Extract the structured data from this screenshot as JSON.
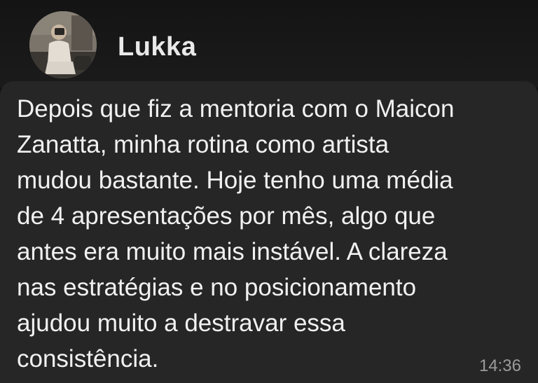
{
  "contact": {
    "name": "Lukka",
    "avatar_icon": "profile-photo"
  },
  "message": {
    "text": "Depois que fiz a mentoria com o Maicon\nZanatta, minha rotina como artista\nmudou bastante. Hoje tenho uma média\nde 4 apresentações por mês, algo que\nantes era muito mais instável. A clareza\nnas estratégias e no posicionamento\najudou muito a destravar essa\nconsistência.",
    "time": "14:36"
  },
  "colors": {
    "background": "#121212",
    "bubble": "#262626",
    "text": "#f1f1f1",
    "time": "#9b9b9b"
  }
}
